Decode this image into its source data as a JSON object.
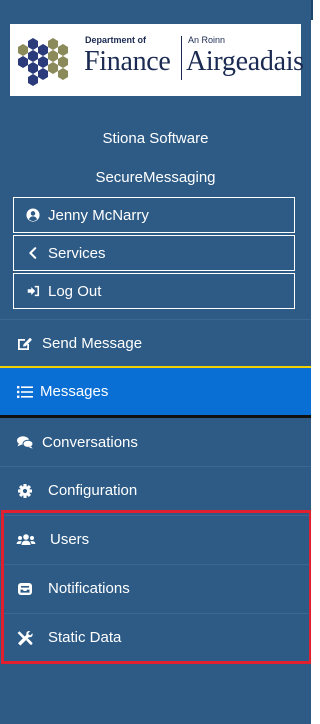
{
  "logo": {
    "dept_en_small": "Department of",
    "dept_en_large": "Finance",
    "dept_ga_small": "An Roinn",
    "dept_ga_large": "Airgeadais"
  },
  "app": {
    "vendor": "Stiona Software",
    "product": "SecureMessaging"
  },
  "user_menu": {
    "username": "Jenny McNarry",
    "services": "Services",
    "logout": "Log Out"
  },
  "nav": {
    "items": [
      {
        "label": "Send Message",
        "icon": "edit-icon"
      },
      {
        "label": "Messages",
        "icon": "list-icon",
        "active": true
      },
      {
        "label": "Conversations",
        "icon": "comments-icon"
      },
      {
        "label": "Configuration",
        "icon": "gear-icon"
      },
      {
        "label": "Users",
        "icon": "users-icon"
      },
      {
        "label": "Notifications",
        "icon": "notification-icon"
      },
      {
        "label": "Static Data",
        "icon": "tools-icon"
      }
    ]
  },
  "colors": {
    "sidebar_bg": "#2d5b86",
    "active_bg": "#0a6fd4",
    "active_top_border": "#f0d000",
    "highlight": "#e0202f",
    "logo_navy": "#1b2a52"
  }
}
